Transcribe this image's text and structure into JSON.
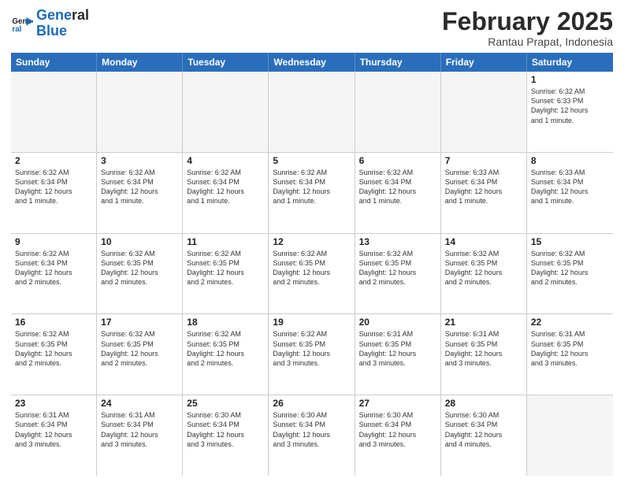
{
  "logo": {
    "line1": "General",
    "line2": "Blue"
  },
  "title": "February 2025",
  "subtitle": "Rantau Prapat, Indonesia",
  "weekdays": [
    "Sunday",
    "Monday",
    "Tuesday",
    "Wednesday",
    "Thursday",
    "Friday",
    "Saturday"
  ],
  "rows": [
    [
      {
        "day": "",
        "info": ""
      },
      {
        "day": "",
        "info": ""
      },
      {
        "day": "",
        "info": ""
      },
      {
        "day": "",
        "info": ""
      },
      {
        "day": "",
        "info": ""
      },
      {
        "day": "",
        "info": ""
      },
      {
        "day": "1",
        "info": "Sunrise: 6:32 AM\nSunset: 6:33 PM\nDaylight: 12 hours\nand 1 minute."
      }
    ],
    [
      {
        "day": "2",
        "info": "Sunrise: 6:32 AM\nSunset: 6:34 PM\nDaylight: 12 hours\nand 1 minute."
      },
      {
        "day": "3",
        "info": "Sunrise: 6:32 AM\nSunset: 6:34 PM\nDaylight: 12 hours\nand 1 minute."
      },
      {
        "day": "4",
        "info": "Sunrise: 6:32 AM\nSunset: 6:34 PM\nDaylight: 12 hours\nand 1 minute."
      },
      {
        "day": "5",
        "info": "Sunrise: 6:32 AM\nSunset: 6:34 PM\nDaylight: 12 hours\nand 1 minute."
      },
      {
        "day": "6",
        "info": "Sunrise: 6:32 AM\nSunset: 6:34 PM\nDaylight: 12 hours\nand 1 minute."
      },
      {
        "day": "7",
        "info": "Sunrise: 6:33 AM\nSunset: 6:34 PM\nDaylight: 12 hours\nand 1 minute."
      },
      {
        "day": "8",
        "info": "Sunrise: 6:33 AM\nSunset: 6:34 PM\nDaylight: 12 hours\nand 1 minute."
      }
    ],
    [
      {
        "day": "9",
        "info": "Sunrise: 6:32 AM\nSunset: 6:34 PM\nDaylight: 12 hours\nand 2 minutes."
      },
      {
        "day": "10",
        "info": "Sunrise: 6:32 AM\nSunset: 6:35 PM\nDaylight: 12 hours\nand 2 minutes."
      },
      {
        "day": "11",
        "info": "Sunrise: 6:32 AM\nSunset: 6:35 PM\nDaylight: 12 hours\nand 2 minutes."
      },
      {
        "day": "12",
        "info": "Sunrise: 6:32 AM\nSunset: 6:35 PM\nDaylight: 12 hours\nand 2 minutes."
      },
      {
        "day": "13",
        "info": "Sunrise: 6:32 AM\nSunset: 6:35 PM\nDaylight: 12 hours\nand 2 minutes."
      },
      {
        "day": "14",
        "info": "Sunrise: 6:32 AM\nSunset: 6:35 PM\nDaylight: 12 hours\nand 2 minutes."
      },
      {
        "day": "15",
        "info": "Sunrise: 6:32 AM\nSunset: 6:35 PM\nDaylight: 12 hours\nand 2 minutes."
      }
    ],
    [
      {
        "day": "16",
        "info": "Sunrise: 6:32 AM\nSunset: 6:35 PM\nDaylight: 12 hours\nand 2 minutes."
      },
      {
        "day": "17",
        "info": "Sunrise: 6:32 AM\nSunset: 6:35 PM\nDaylight: 12 hours\nand 2 minutes."
      },
      {
        "day": "18",
        "info": "Sunrise: 6:32 AM\nSunset: 6:35 PM\nDaylight: 12 hours\nand 2 minutes."
      },
      {
        "day": "19",
        "info": "Sunrise: 6:32 AM\nSunset: 6:35 PM\nDaylight: 12 hours\nand 3 minutes."
      },
      {
        "day": "20",
        "info": "Sunrise: 6:31 AM\nSunset: 6:35 PM\nDaylight: 12 hours\nand 3 minutes."
      },
      {
        "day": "21",
        "info": "Sunrise: 6:31 AM\nSunset: 6:35 PM\nDaylight: 12 hours\nand 3 minutes."
      },
      {
        "day": "22",
        "info": "Sunrise: 6:31 AM\nSunset: 6:35 PM\nDaylight: 12 hours\nand 3 minutes."
      }
    ],
    [
      {
        "day": "23",
        "info": "Sunrise: 6:31 AM\nSunset: 6:34 PM\nDaylight: 12 hours\nand 3 minutes."
      },
      {
        "day": "24",
        "info": "Sunrise: 6:31 AM\nSunset: 6:34 PM\nDaylight: 12 hours\nand 3 minutes."
      },
      {
        "day": "25",
        "info": "Sunrise: 6:30 AM\nSunset: 6:34 PM\nDaylight: 12 hours\nand 3 minutes."
      },
      {
        "day": "26",
        "info": "Sunrise: 6:30 AM\nSunset: 6:34 PM\nDaylight: 12 hours\nand 3 minutes."
      },
      {
        "day": "27",
        "info": "Sunrise: 6:30 AM\nSunset: 6:34 PM\nDaylight: 12 hours\nand 3 minutes."
      },
      {
        "day": "28",
        "info": "Sunrise: 6:30 AM\nSunset: 6:34 PM\nDaylight: 12 hours\nand 4 minutes."
      },
      {
        "day": "",
        "info": ""
      }
    ]
  ]
}
